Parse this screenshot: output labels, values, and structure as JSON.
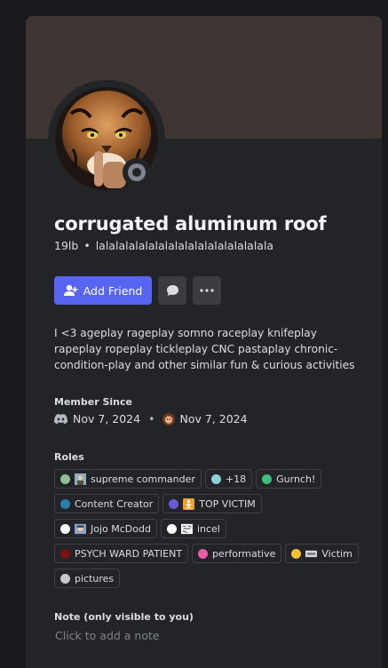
{
  "profile": {
    "display_name": "corrugated aluminum roof",
    "pronoun_tag": "19lb",
    "username": "lalalalalalalalalalalalalalalalalala",
    "status": "offline"
  },
  "actions": {
    "add_friend_label": "Add Friend",
    "message_icon": "chat-bubble-icon",
    "more_icon": "ellipsis-icon"
  },
  "bio": "I <3 ageplay rageplay somno raceplay knifeplay rapeplay ropeplay tickleplay CNC pastaplay chronic-condition-play and other similar fun & curious activities",
  "member_since": {
    "title": "Member Since",
    "discord_date": "Nov 7, 2024",
    "server_date": "Nov 7, 2024"
  },
  "roles": {
    "title": "Roles",
    "rows": [
      [
        {
          "name": "supreme commander",
          "color": "#8fbf92",
          "icon": "portrait-icon"
        },
        {
          "name": "+18",
          "color": "#8ad1d8"
        },
        {
          "name": "Gurnch!",
          "color": "#3bbf7a"
        }
      ],
      [
        {
          "name": "Content Creator",
          "color": "#2a7fa8"
        },
        {
          "name": "TOP VICTIM",
          "color": "#6b5bd6",
          "icon": "figure-icon"
        }
      ],
      [
        {
          "name": "Jojo McDodd",
          "color": "#ffffff",
          "icon": "face-icon"
        },
        {
          "name": "incel",
          "color": "#ffffff",
          "icon": "sketch-icon"
        }
      ],
      [
        {
          "name": "PSYCH WARD PATIENT",
          "color": "#7a1010"
        },
        {
          "name": "performative",
          "color": "#ea5aa8"
        },
        {
          "name": "Victim",
          "color": "#f1c232",
          "icon": "tag-icon"
        }
      ],
      [
        {
          "name": "pictures",
          "color": "#c8c8cc"
        }
      ]
    ]
  },
  "note": {
    "title": "Note (only visible to you)",
    "placeholder": "Click to add a note"
  },
  "colors": {
    "accent": "#5865f2",
    "banner": "#3e3532",
    "card": "#232428",
    "background": "#1a1a1e"
  }
}
